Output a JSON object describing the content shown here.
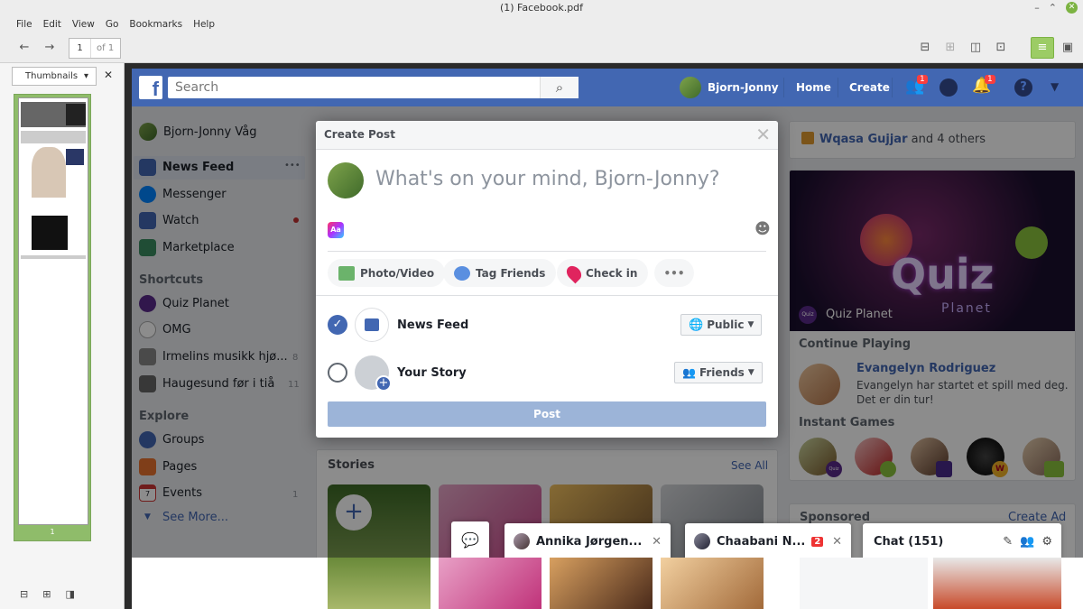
{
  "window": {
    "title": "(1) Facebook.pdf"
  },
  "menu": [
    "File",
    "Edit",
    "View",
    "Go",
    "Bookmarks",
    "Help"
  ],
  "toolbar": {
    "page_current": "1",
    "page_total": "of 1"
  },
  "sidepanel": {
    "mode": "Thumbnails",
    "page_label": "1"
  },
  "fb": {
    "logo": "f",
    "search_placeholder": "Search",
    "user": "Bjorn-Jonny",
    "nav_home": "Home",
    "nav_create": "Create",
    "friends_badge": "1",
    "notif_badge": "1",
    "left": {
      "profile": "Bjorn-Jonny Våg",
      "items": [
        {
          "label": "News Feed",
          "color": "#4267b2"
        },
        {
          "label": "Messenger",
          "color": "#0084ff"
        },
        {
          "label": "Watch",
          "color": "#4267b2"
        },
        {
          "label": "Marketplace",
          "color": "#3b8d62"
        }
      ],
      "more_dots": "•••",
      "shortcuts_title": "Shortcuts",
      "shortcuts": [
        {
          "label": "Quiz Planet",
          "count": ""
        },
        {
          "label": "OMG",
          "count": ""
        },
        {
          "label": "Irmelins musikk hjø...",
          "count": "8"
        },
        {
          "label": "Haugesund før i tiå",
          "count": "11"
        }
      ],
      "explore_title": "Explore",
      "explore": [
        {
          "label": "Groups",
          "count": ""
        },
        {
          "label": "Pages",
          "count": ""
        },
        {
          "label": "Events",
          "count": "1"
        }
      ],
      "see_more": "See More...",
      "events_day": "7"
    },
    "modal": {
      "title": "Create Post",
      "prompt": "What's on your mind, Bjorn-Jonny?",
      "aa": "Aa",
      "emoji": "☻",
      "photo": "Photo/Video",
      "tag": "Tag Friends",
      "checkin": "Check in",
      "more": "•••",
      "newsfeed": "News Feed",
      "public": "Public",
      "story": "Your Story",
      "friends": "Friends",
      "post": "Post"
    },
    "stories": {
      "title": "Stories",
      "see_all": "See All",
      "add": "+"
    },
    "right": {
      "birthday_name": "Wqasa Gujjar",
      "birthday_rest": "and 4 others",
      "quiz_word": "Quiz",
      "quiz_sub": "Planet",
      "quiz_label": "Quiz Planet",
      "quiz_badge": "Quiz",
      "continue": "Continue Playing",
      "player_name": "Evangelyn Rodriguez",
      "player_msg_glyphs": "",
      "player_msg": "Evangelyn har startet et spill med deg. Det er din tur!",
      "instant": "Instant Games",
      "game_badges": [
        "Quiz",
        "",
        "",
        "W",
        ""
      ],
      "sponsored": "Sponsored",
      "create_ad": "Create Ad"
    },
    "chat": {
      "tab1": "Annika Jørgen...",
      "tab2": "Chaabani N...",
      "tab2_badge": "2",
      "main": "Chat (151)"
    }
  }
}
